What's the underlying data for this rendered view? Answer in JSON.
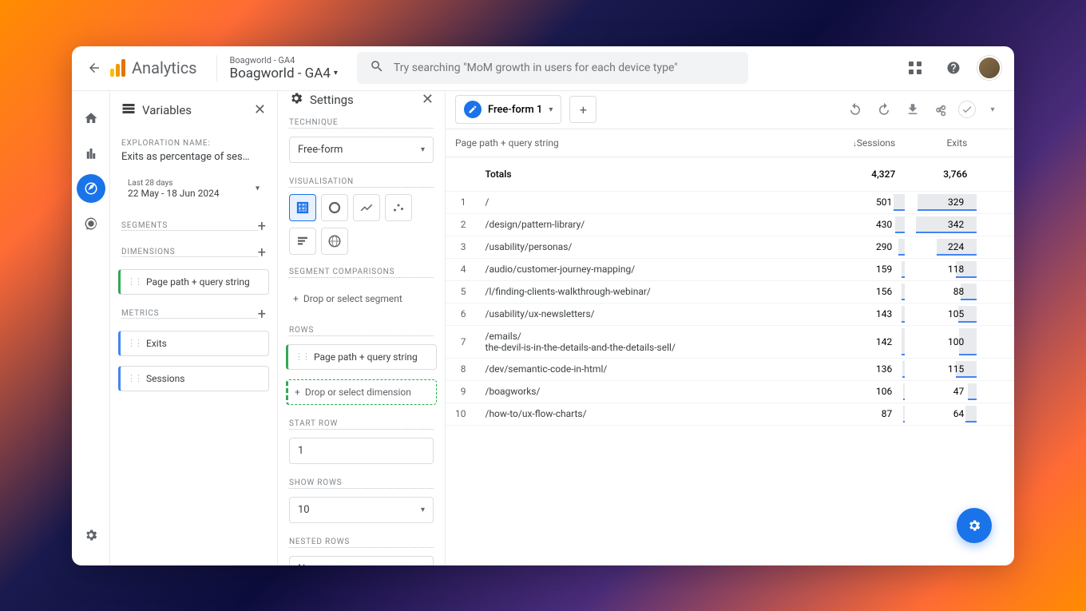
{
  "app_name": "Analytics",
  "breadcrumb_small": "Boagworld - GA4",
  "breadcrumb_big": "Boagworld - GA4",
  "search_placeholder": "Try searching \"MoM growth in users for each device type\"",
  "variables": {
    "title": "Variables",
    "exp_label": "EXPLORATION NAME:",
    "exp_name": "Exits as percentage of ses…",
    "date_small": "Last 28 days",
    "date_range": "22 May - 18 Jun 2024",
    "segments_label": "SEGMENTS",
    "dimensions_label": "DIMENSIONS",
    "dimension_chip": "Page path + query string",
    "metrics_label": "METRICS",
    "metric_chips": [
      "Exits",
      "Sessions"
    ]
  },
  "settings": {
    "title": "Settings",
    "technique_label": "TECHNIQUE",
    "technique_value": "Free-form",
    "viz_label": "VISUALISATION",
    "seg_comp_label": "SEGMENT COMPARISONS",
    "seg_drop": "Drop or select segment",
    "rows_label": "ROWS",
    "row_chip": "Page path + query string",
    "row_drop": "Drop or select dimension",
    "start_row_label": "START ROW",
    "start_row": "1",
    "show_rows_label": "SHOW ROWS",
    "show_rows": "10",
    "nested_label": "NESTED ROWS",
    "nested_value": "No"
  },
  "tab": {
    "name": "Free-form 1"
  },
  "table": {
    "header_dim": "Page path + query string",
    "header_sessions": "Sessions",
    "header_exits": "Exits",
    "totals_label": "Totals",
    "totals_sessions": "4,327",
    "totals_exits": "3,766",
    "rows": [
      {
        "n": "1",
        "path": "/",
        "sessions": "501",
        "exits": "329",
        "sw": 16,
        "ew": 82
      },
      {
        "n": "2",
        "path": "/design/pattern-library/",
        "sessions": "430",
        "exits": "342",
        "sw": 14,
        "ew": 85
      },
      {
        "n": "3",
        "path": "/usability/personas/",
        "sessions": "290",
        "exits": "224",
        "sw": 9,
        "ew": 56
      },
      {
        "n": "4",
        "path": "/audio/customer-journey-mapping/",
        "sessions": "159",
        "exits": "118",
        "sw": 5,
        "ew": 29
      },
      {
        "n": "5",
        "path": "/l/finding-clients-walkthrough-webinar/",
        "sessions": "156",
        "exits": "88",
        "sw": 5,
        "ew": 22
      },
      {
        "n": "6",
        "path": "/usability/ux-newsletters/",
        "sessions": "143",
        "exits": "105",
        "sw": 5,
        "ew": 26
      },
      {
        "n": "7",
        "path": "/emails/\nthe-devil-is-in-the-details-and-the-details-sell/",
        "sessions": "142",
        "exits": "100",
        "sw": 5,
        "ew": 25
      },
      {
        "n": "8",
        "path": "/dev/semantic-code-in-html/",
        "sessions": "136",
        "exits": "115",
        "sw": 4,
        "ew": 29
      },
      {
        "n": "9",
        "path": "/boagworks/",
        "sessions": "106",
        "exits": "47",
        "sw": 3,
        "ew": 12
      },
      {
        "n": "10",
        "path": "/how-to/ux-flow-charts/",
        "sessions": "87",
        "exits": "64",
        "sw": 3,
        "ew": 16
      }
    ]
  },
  "chart_data": {
    "type": "table",
    "title": "Free-form 1",
    "dimension": "Page path + query string",
    "metrics": [
      "Sessions",
      "Exits"
    ],
    "totals": {
      "Sessions": 4327,
      "Exits": 3766
    },
    "rows": [
      {
        "path": "/",
        "Sessions": 501,
        "Exits": 329
      },
      {
        "path": "/design/pattern-library/",
        "Sessions": 430,
        "Exits": 342
      },
      {
        "path": "/usability/personas/",
        "Sessions": 290,
        "Exits": 224
      },
      {
        "path": "/audio/customer-journey-mapping/",
        "Sessions": 159,
        "Exits": 118
      },
      {
        "path": "/l/finding-clients-walkthrough-webinar/",
        "Sessions": 156,
        "Exits": 88
      },
      {
        "path": "/usability/ux-newsletters/",
        "Sessions": 143,
        "Exits": 105
      },
      {
        "path": "/emails/the-devil-is-in-the-details-and-the-details-sell/",
        "Sessions": 142,
        "Exits": 100
      },
      {
        "path": "/dev/semantic-code-in-html/",
        "Sessions": 136,
        "Exits": 115
      },
      {
        "path": "/boagworks/",
        "Sessions": 106,
        "Exits": 47
      },
      {
        "path": "/how-to/ux-flow-charts/",
        "Sessions": 87,
        "Exits": 64
      }
    ]
  }
}
